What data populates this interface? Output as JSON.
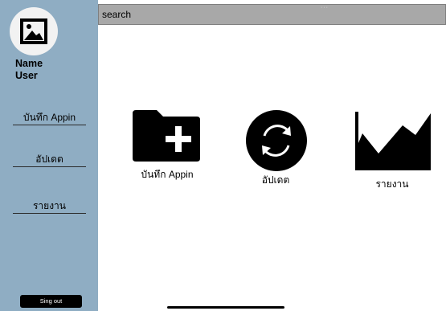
{
  "user": {
    "name_label": "Name\nUser",
    "avatar_icon": "image-icon"
  },
  "sidebar": {
    "items": [
      {
        "label": "บันทึก Appin"
      },
      {
        "label": "อัปเดต"
      },
      {
        "label": "รายงาน"
      }
    ],
    "signout_label": "Sing out",
    "background_color": "#8fadc3"
  },
  "search": {
    "placeholder": "search",
    "background_color": "#a8a8a8",
    "handle_dots": "···"
  },
  "main": {
    "tiles": [
      {
        "label": "บันทึก Appin",
        "icon": "folder-add-icon"
      },
      {
        "label": "อัปเดต",
        "icon": "refresh-icon"
      },
      {
        "label": "รายงาน",
        "icon": "area-chart-icon"
      }
    ]
  }
}
